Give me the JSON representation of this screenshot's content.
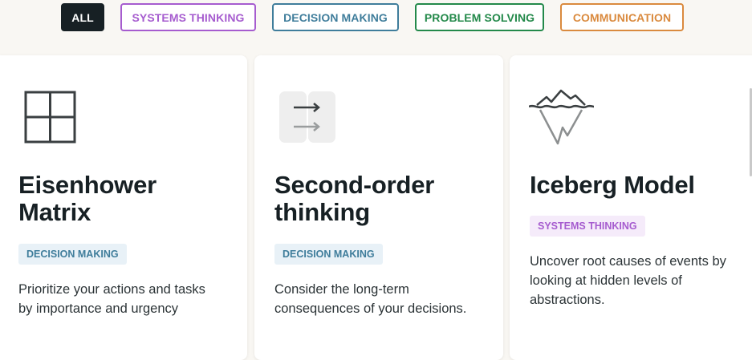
{
  "filters": [
    {
      "label": "ALL"
    },
    {
      "label": "SYSTEMS THINKING"
    },
    {
      "label": "DECISION MAKING"
    },
    {
      "label": "PROBLEM SOLVING"
    },
    {
      "label": "COMMUNICATION"
    }
  ],
  "cards": [
    {
      "icon": "grid-matrix-icon",
      "title_line1": "Eisenhower",
      "title_line2": "Matrix",
      "tag": "DECISION MAKING",
      "desc_line1": "Prioritize your actions and tasks",
      "desc_line2": "by importance and urgency"
    },
    {
      "icon": "arrows-right-icon",
      "title_line1": "Second-order",
      "title_line2": "thinking",
      "tag": "DECISION MAKING",
      "desc_line1": "Consider the long-term",
      "desc_line2": "consequences of your decisions."
    },
    {
      "icon": "iceberg-icon",
      "title_line1": "Iceberg Model",
      "tag": "SYSTEMS THINKING",
      "desc_line1": "Uncover root causes of events by",
      "desc_line2": "looking at hidden levels of",
      "desc_line3": "abstractions."
    }
  ],
  "colors": {
    "all": "#172024",
    "systems_thinking": "#a65ccf",
    "decision_making": "#3f7d9b",
    "problem_solving": "#23894a",
    "communication": "#da8a3e"
  }
}
